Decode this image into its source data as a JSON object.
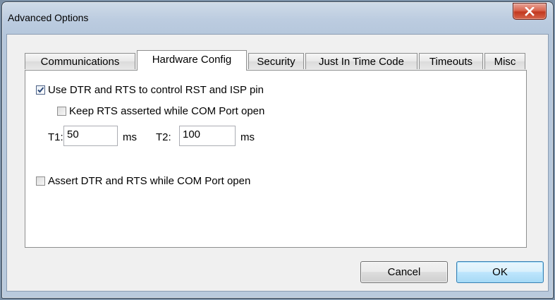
{
  "window": {
    "title": "Advanced Options"
  },
  "tabs": [
    {
      "label": "Communications",
      "active": false
    },
    {
      "label": "Hardware Config",
      "active": true
    },
    {
      "label": "Security",
      "active": false
    },
    {
      "label": "Just In Time Code",
      "active": false
    },
    {
      "label": "Timeouts",
      "active": false
    },
    {
      "label": "Misc",
      "active": false
    }
  ],
  "hardware_config": {
    "use_dtr_rts": {
      "label": "Use DTR and RTS to control RST and ISP pin",
      "checked": true
    },
    "keep_rts": {
      "label": "Keep RTS asserted while COM Port open",
      "checked": false
    },
    "t1": {
      "label": "T1:",
      "value": "50",
      "unit": "ms"
    },
    "t2": {
      "label": "T2:",
      "value": "100",
      "unit": "ms"
    },
    "assert_dtr_rts": {
      "label": "Assert DTR and RTS while COM Port open",
      "checked": false
    }
  },
  "buttons": {
    "cancel": "Cancel",
    "ok": "OK"
  },
  "icons": {
    "close": "close-icon",
    "check": "checkmark-icon"
  }
}
